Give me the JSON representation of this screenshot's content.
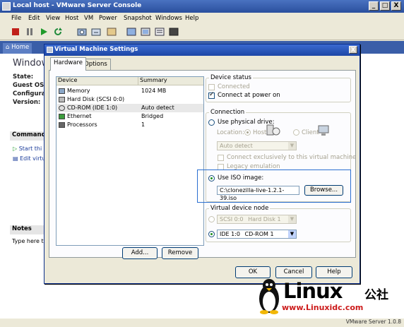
{
  "outer_window": {
    "title": "Local host - VMware Server Console",
    "controls": [
      "_",
      "□",
      "X"
    ]
  },
  "menu": [
    "File",
    "Edit",
    "View",
    "Host",
    "VM",
    "Power",
    "Snapshot",
    "Windows",
    "Help"
  ],
  "tabs": {
    "home": "Home"
  },
  "summary": {
    "heading": "Window",
    "labels": [
      "State:",
      "Guest OS:",
      "Configurati",
      "Version:"
    ],
    "commands_header": "Commands",
    "commands": [
      "Start thi",
      "Edit virtu"
    ],
    "notes_header": "Notes",
    "notes_placeholder": "Type here to"
  },
  "dialog": {
    "title": "Virtual Machine Settings",
    "close": "X",
    "tabs": [
      "Hardware",
      "Options"
    ],
    "device_list": {
      "headers": [
        "Device",
        "Summary"
      ],
      "rows": [
        {
          "device": "Memory",
          "summary": "1024 MB",
          "icon": "memory-icon"
        },
        {
          "device": "Hard Disk (SCSI 0:0)",
          "summary": "",
          "icon": "hard-disk-icon"
        },
        {
          "device": "CD-ROM (IDE 1:0)",
          "summary": "Auto detect",
          "icon": "cdrom-icon"
        },
        {
          "device": "Ethernet",
          "summary": "Bridged",
          "icon": "ethernet-icon"
        },
        {
          "device": "Processors",
          "summary": "1",
          "icon": "processor-icon"
        }
      ],
      "selected_row": 2
    },
    "add_button": "Add...",
    "remove_button": "Remove",
    "device_status": {
      "legend": "Device status",
      "connected": "Connected",
      "connect_at_power_on": "Connect at power on"
    },
    "connection": {
      "legend": "Connection",
      "use_physical_drive": "Use physical drive:",
      "location_label": "Location:",
      "host": "Host",
      "client": "Client",
      "physical_select": "Auto detect",
      "connect_exclusively": "Connect exclusively to this virtual machine",
      "legacy_emulation": "Legacy emulation",
      "use_iso": "Use ISO image:",
      "iso_path": "C:\\clonezilla-live-1.2.1-39.iso",
      "browse": "Browse..."
    },
    "virtual_device_node": {
      "legend": "Virtual device node",
      "scsi_node": "SCSI 0:0",
      "scsi_select": "Hard Disk 1",
      "ide_node": "IDE 1:0",
      "ide_select": "CD-ROM 1"
    },
    "ok": "OK",
    "cancel": "Cancel",
    "help": "Help"
  },
  "watermark": {
    "brand": "Linux",
    "brand_cn": "公社",
    "url": "www.Linuxidc.com"
  },
  "status_bar": {
    "version": "VMware Server 1.0.8"
  },
  "colors": {
    "titlebar": "#2a4f9e",
    "dialog_face": "#ece9d8",
    "highlight_box": "#2a6fd1",
    "watermark_red": "#cc1a1a"
  }
}
